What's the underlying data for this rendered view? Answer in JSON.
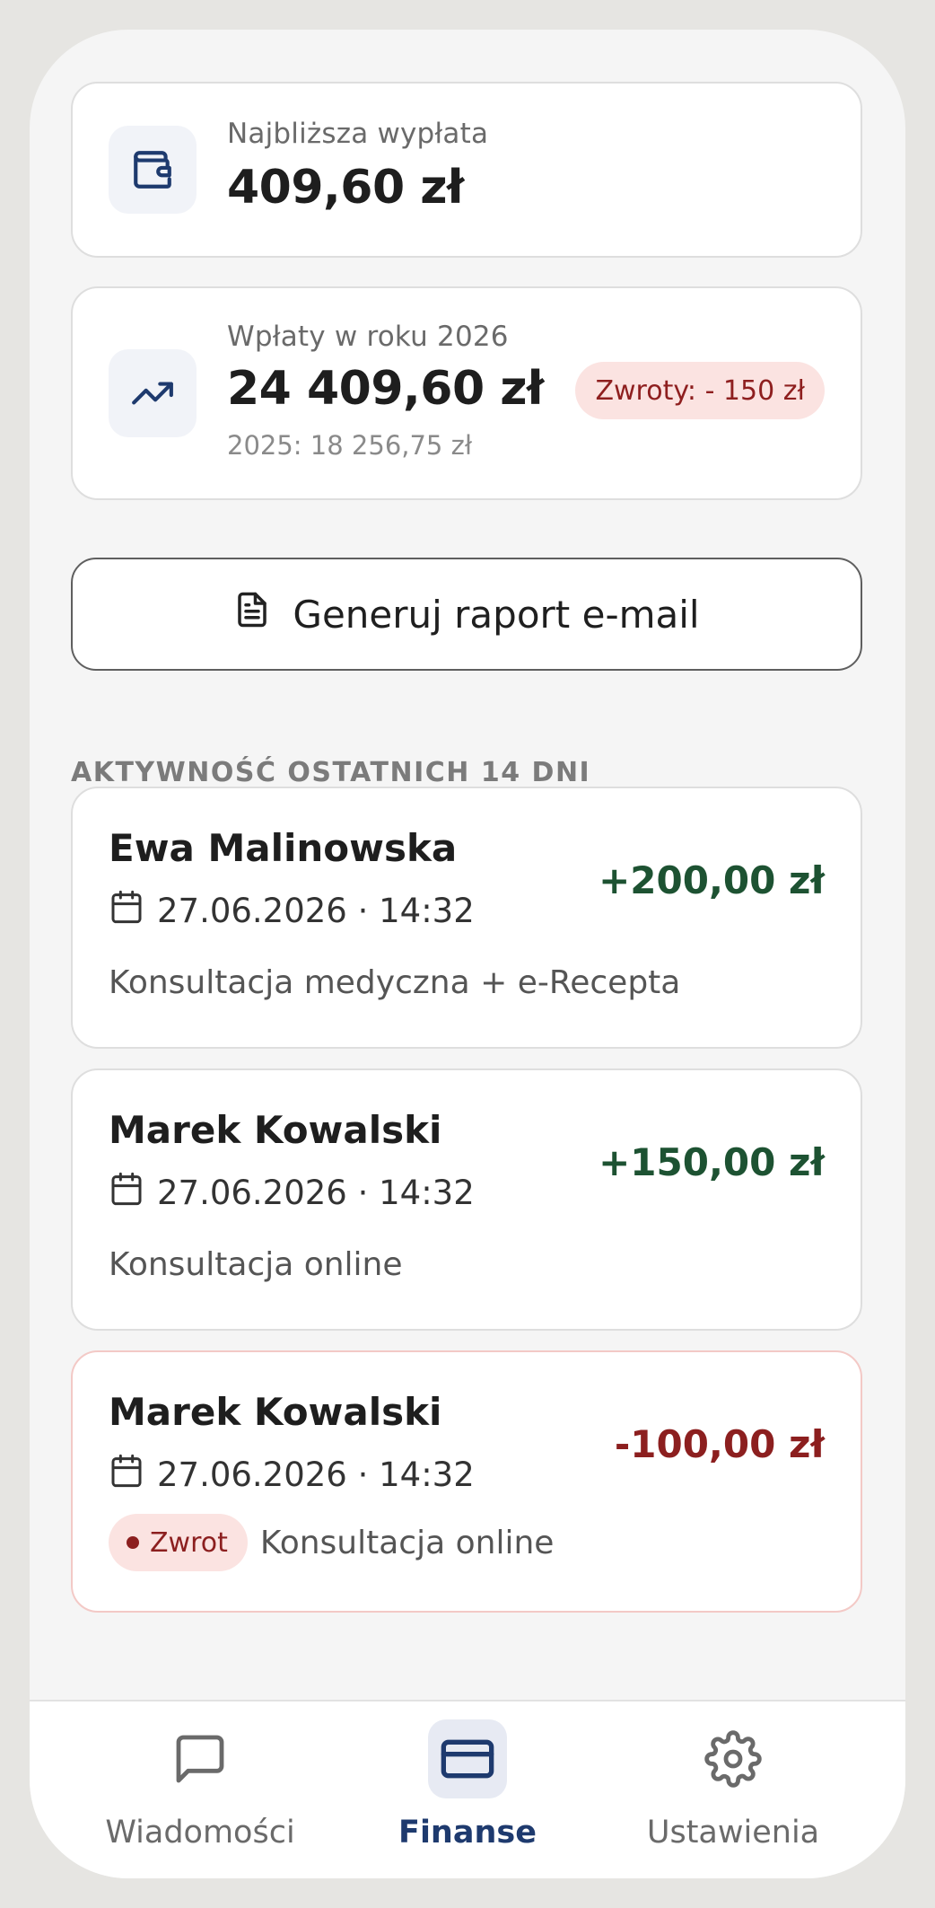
{
  "payout_card": {
    "label": "Najbliższa wypłata",
    "amount": "409,60 zł",
    "icon": "wallet-icon"
  },
  "income_card": {
    "label": "Wpłaty w roku 2026",
    "amount": "24 409,60 zł",
    "previous_year": "2025: 18 256,75 zł",
    "refunds_badge": "Zwroty: - 150 zł",
    "icon": "trending-up-icon"
  },
  "report_button": {
    "label": "Generuj raport e-mail",
    "icon": "document-icon"
  },
  "activity": {
    "title": "AKTYWNOŚĆ OSTATNICH 14 DNI",
    "items": [
      {
        "name": "Ewa Malinowska",
        "datetime": "27.06.2026 · 14:32",
        "description": "Konsultacja medyczna + e-Recepta",
        "amount": "+200,00 zł"
      },
      {
        "name": "Marek Kowalski",
        "datetime": "27.06.2026 · 14:32",
        "description": "Konsultacja online",
        "amount": "+150,00 zł"
      },
      {
        "name": "Marek Kowalski",
        "datetime": "27.06.2026 · 14:32",
        "description": "Konsultacja online",
        "amount": "-100,00 zł",
        "badge": "Zwrot"
      }
    ]
  },
  "tabbar": {
    "tabs": [
      {
        "label": "Wiadomości",
        "icon": "chat-icon"
      },
      {
        "label": "Finanse",
        "icon": "card-icon",
        "active": true
      },
      {
        "label": "Ustawienia",
        "icon": "gear-icon"
      }
    ]
  },
  "colors": {
    "accent": "#1e3a6e",
    "positive": "#1d5232",
    "negative": "#8c1f1f",
    "refund_bg": "#fbe3e1"
  }
}
